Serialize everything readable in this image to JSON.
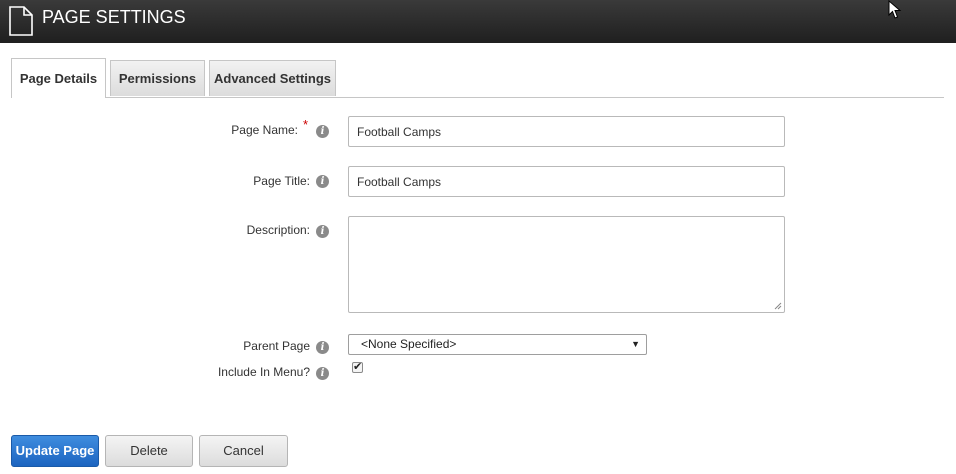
{
  "header": {
    "title": "PAGE SETTINGS",
    "icon": "page-icon",
    "cursor_icon": "mouse-pointer-icon"
  },
  "tabs": [
    {
      "label": "Page Details",
      "active": true
    },
    {
      "label": "Permissions",
      "active": false
    },
    {
      "label": "Advanced Settings",
      "active": false
    }
  ],
  "form": {
    "page_name": {
      "label": "Page Name:",
      "required_marker": "*",
      "value": "Football Camps",
      "info_icon": "info-icon"
    },
    "page_title": {
      "label": "Page Title:",
      "value": "Football Camps",
      "info_icon": "info-icon"
    },
    "description": {
      "label": "Description:",
      "value": "",
      "info_icon": "info-icon"
    },
    "parent_page": {
      "label": "Parent Page",
      "selected": "<None Specified>",
      "info_icon": "info-icon"
    },
    "include_in_menu": {
      "label": "Include In Menu?",
      "checked": true,
      "info_icon": "info-icon"
    }
  },
  "buttons": {
    "update": "Update Page",
    "delete": "Delete",
    "cancel": "Cancel"
  },
  "colors": {
    "primary_button": "#1c64c0",
    "required": "#cc0000",
    "header_bg": "#262626"
  }
}
